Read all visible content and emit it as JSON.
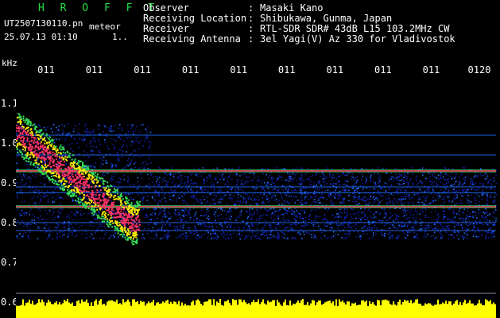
{
  "header": {
    "brand": "H R O F F T",
    "filename": "UT2507130110.pn",
    "meteor_label": "meteor",
    "datetime": "25.07.13 01:10",
    "marker": "1..",
    "info": [
      {
        "label": "Observer",
        "value": "Masaki Kano"
      },
      {
        "label": "Receiving Location",
        "value": "Shibukawa, Gunma, Japan"
      },
      {
        "label": "Receiver",
        "value": "RTL-SDR SDR# 43dB L15 103.2MHz CW"
      },
      {
        "label": "Receiving Antenna",
        "value": "3el Yagi(V) Az 330 for Vladivostok"
      }
    ],
    "separator": ":"
  },
  "chart_data": {
    "type": "heatmap",
    "ylabel": "kHz",
    "x_ticks": [
      "011",
      "011",
      "011",
      "011",
      "011",
      "011",
      "011",
      "011",
      "011",
      "0120"
    ],
    "y_ticks": [
      "1.1",
      "1.0",
      "0.9",
      "0.8",
      "0.7",
      "0.6"
    ],
    "ylim": [
      0.6,
      1.1
    ],
    "steady_carrier_lines_khz": [
      0.93,
      0.84
    ],
    "faint_carrier_lines_khz": [
      1.02,
      0.97,
      0.89,
      0.875,
      0.8,
      0.78
    ],
    "meteor_echo": {
      "start_khz": 1.03,
      "end_khz": 0.8,
      "start_fraction": 0.0,
      "end_fraction": 0.24
    },
    "palette": {
      "background": "#000000",
      "noise_low": "#1020a0",
      "noise_mid": "#2070ff",
      "echo": "#ff3366",
      "hot": "#ffee00",
      "power_strip": "#ffff00",
      "axis": "#ffffff"
    }
  }
}
